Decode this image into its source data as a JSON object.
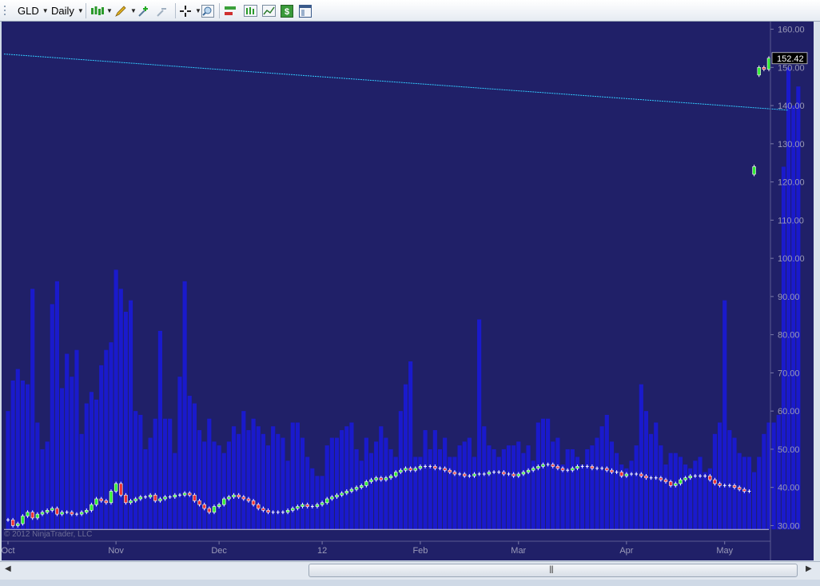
{
  "toolbar": {
    "instrument": "GLD",
    "period": "Daily"
  },
  "colors": {
    "background": "#202068",
    "volume": "#1a1acc",
    "up_candle": "#33ee33",
    "down_candle": "#ee3333",
    "trendline": "#33ccff",
    "axis_text": "#9a9ab8",
    "price_marker_bg": "#000000"
  },
  "copyright": "© 2012 NinjaTrader, LLC",
  "price_marker": "152.42",
  "chart_data": {
    "type": "candlestick",
    "instrument": "GLD",
    "period": "Daily",
    "ylim": [
      28,
      162
    ],
    "y_ticks": [
      "30.00",
      "40.00",
      "50.00",
      "60.00",
      "70.00",
      "80.00",
      "90.00",
      "100.00",
      "110.00",
      "120.00",
      "130.00",
      "140.00",
      "150.00",
      "160.00"
    ],
    "x_labels": [
      {
        "label": "Oct",
        "index": 0
      },
      {
        "label": "Nov",
        "index": 22
      },
      {
        "label": "Dec",
        "index": 43
      },
      {
        "label": "12",
        "index": 64
      },
      {
        "label": "Feb",
        "index": 84
      },
      {
        "label": "Mar",
        "index": 104
      },
      {
        "label": "Apr",
        "index": 126
      },
      {
        "label": "May",
        "index": 146
      }
    ],
    "trendline": {
      "start_index": 0,
      "start_value": 153.5,
      "end_index": 159,
      "end_value": 138.8
    },
    "baseline": 29,
    "last_price": 152.42,
    "close": [
      31.5,
      30.0,
      30.5,
      32.5,
      33.5,
      32.0,
      33.0,
      33.5,
      34.0,
      34.5,
      33.0,
      33.5,
      33.5,
      33.0,
      33.0,
      33.5,
      34.0,
      35.5,
      37.0,
      36.5,
      36.0,
      39.0,
      41.0,
      38.0,
      36.0,
      36.5,
      37.0,
      37.5,
      37.5,
      38.0,
      36.5,
      37.0,
      37.5,
      37.5,
      38.0,
      38.0,
      38.5,
      38.0,
      36.5,
      35.5,
      34.5,
      33.5,
      35.0,
      35.5,
      37.0,
      37.5,
      38.0,
      37.5,
      37.0,
      36.5,
      35.5,
      34.5,
      34.0,
      33.5,
      33.5,
      33.5,
      33.5,
      34.0,
      34.5,
      35.0,
      35.5,
      35.0,
      35.0,
      35.5,
      36.0,
      37.0,
      37.5,
      38.0,
      38.5,
      39.0,
      39.5,
      40.0,
      40.5,
      41.5,
      42.0,
      42.5,
      42.0,
      42.5,
      43.0,
      44.0,
      44.5,
      45.0,
      44.5,
      45.0,
      45.5,
      45.5,
      45.5,
      45.0,
      45.0,
      44.5,
      44.0,
      43.5,
      43.5,
      43.0,
      43.0,
      43.5,
      43.5,
      43.5,
      44.0,
      44.0,
      44.0,
      43.5,
      43.5,
      43.0,
      43.5,
      44.0,
      44.5,
      45.0,
      45.5,
      46.0,
      46.0,
      45.5,
      45.0,
      44.5,
      44.5,
      45.0,
      45.5,
      45.5,
      45.5,
      45.0,
      45.0,
      45.0,
      44.5,
      44.0,
      44.0,
      43.0,
      43.5,
      43.5,
      43.5,
      43.0,
      42.5,
      42.5,
      42.5,
      42.0,
      41.5,
      40.5,
      41.0,
      42.0,
      42.5,
      43.0,
      43.0,
      43.0,
      43.0,
      42.0,
      41.0,
      40.5,
      40.5,
      40.5,
      40.0,
      39.5,
      39.0,
      39.0,
      124.0,
      150.0,
      149.5,
      152.42
    ],
    "volume": [
      60,
      68,
      71,
      68,
      67,
      92,
      57,
      50,
      52,
      88,
      94,
      66,
      75,
      69,
      76,
      54,
      62,
      65,
      63,
      72,
      76,
      78,
      97,
      92,
      86,
      89,
      60,
      59,
      50,
      53,
      58,
      81,
      58,
      58,
      49,
      69,
      94,
      64,
      62,
      55,
      52,
      58,
      52,
      51,
      49,
      52,
      56,
      54,
      60,
      55,
      58,
      56,
      54,
      51,
      56,
      54,
      53,
      47,
      57,
      57,
      53,
      48,
      45,
      43,
      43,
      51,
      53,
      53,
      55,
      56,
      57,
      50,
      47,
      53,
      49,
      52,
      56,
      53,
      50,
      48,
      60,
      67,
      73,
      48,
      48,
      55,
      50,
      55,
      50,
      53,
      48,
      48,
      51,
      52,
      53,
      48,
      84,
      56,
      51,
      50,
      48,
      50,
      51,
      51,
      52,
      49,
      51,
      47,
      57,
      58,
      58,
      52,
      53,
      46,
      50,
      50,
      48,
      46,
      50,
      51,
      53,
      56,
      59,
      52,
      49,
      46,
      45,
      47,
      51,
      67,
      60,
      54,
      57,
      51,
      46,
      49,
      49,
      48,
      46,
      45,
      47,
      48,
      44,
      45,
      54,
      57,
      89,
      55,
      53,
      49,
      48,
      48,
      44,
      48,
      54,
      57,
      57,
      59,
      124,
      150,
      140,
      145
    ]
  }
}
